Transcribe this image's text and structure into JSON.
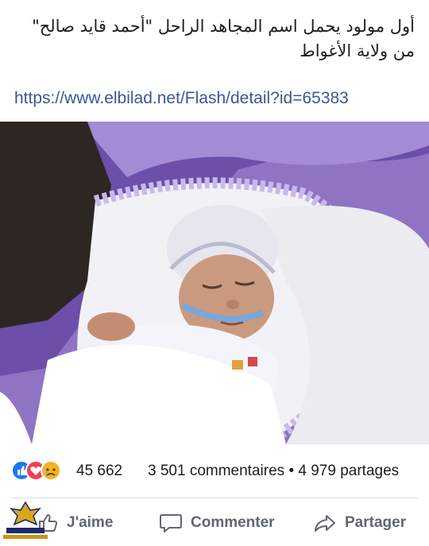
{
  "post": {
    "text": "أول مولود يحمل اسم المجاهد الراحل \"أحمد قايد صالح\" من ولاية الأغواط",
    "link": "https://www.elbilad.net/Flash/detail?id=65383"
  },
  "photo": {
    "subject": "newborn-baby",
    "colors": {
      "blanket": "#9b7fcf",
      "lace": "#ffffff",
      "cap": "#e8e8f2"
    }
  },
  "stats": {
    "reactions": [
      "like-icon",
      "love-icon",
      "sad-icon"
    ],
    "reaction_count": "45 662",
    "comments": "3 501 commentaires",
    "separator": "•",
    "shares": "4 979 partages"
  },
  "actions": {
    "like": "J'aime",
    "comment": "Commenter",
    "share": "Partager"
  },
  "colors": {
    "like_blue": "#1877f2",
    "love_red": "#f33e58",
    "sad_yellow": "#f7b125",
    "link": "#385898",
    "action_gray": "#606770"
  }
}
